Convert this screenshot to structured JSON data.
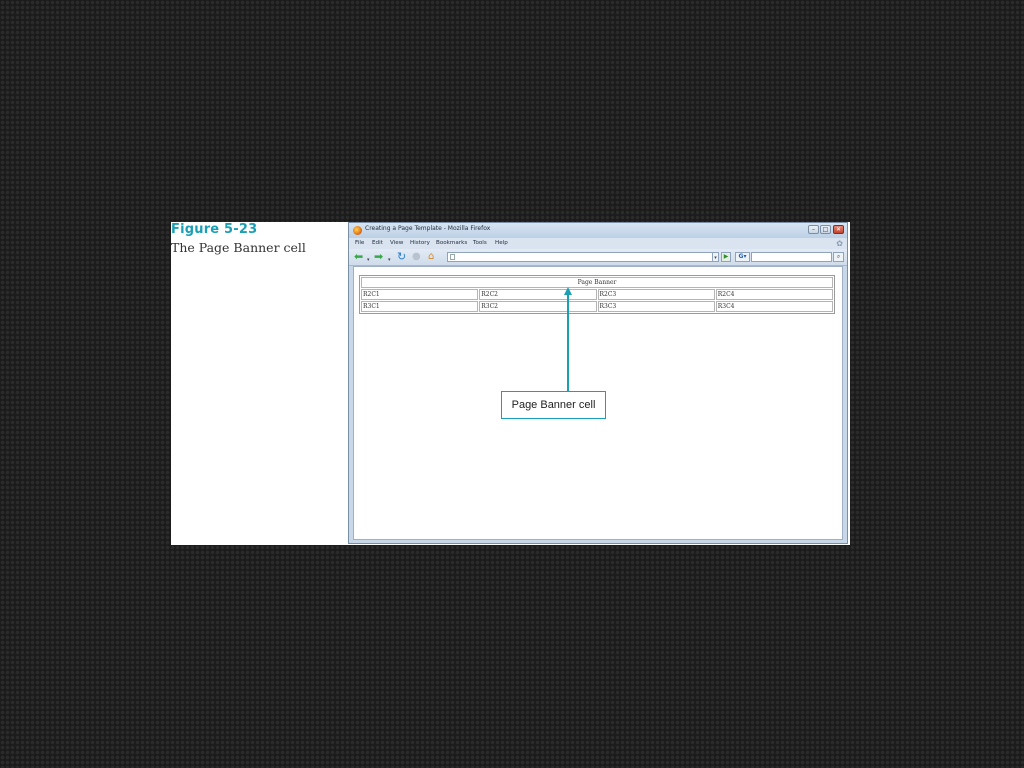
{
  "figure": {
    "number": "Figure 5-23",
    "title": "The Page Banner cell"
  },
  "browser": {
    "window_title": "Creating a Page Template - Mozilla Firefox",
    "menu": [
      "File",
      "Edit",
      "View",
      "History",
      "Bookmarks",
      "Tools",
      "Help"
    ],
    "window_controls": {
      "minimize": "–",
      "maximize": "□",
      "close": "✕"
    }
  },
  "page_table": {
    "banner": "Page Banner",
    "rows": [
      [
        "R2C1",
        "R2C2",
        "R2C3",
        "R2C4"
      ],
      [
        "R3C1",
        "R3C2",
        "R3C3",
        "R3C4"
      ]
    ]
  },
  "callout": {
    "label": "Page Banner cell"
  },
  "colors": {
    "accent": "#1a9fb5",
    "background": "#1b1b1b"
  },
  "icons": [
    "back-icon",
    "forward-icon",
    "reload-icon",
    "stop-icon",
    "home-icon",
    "gear-icon",
    "search-icon"
  ]
}
